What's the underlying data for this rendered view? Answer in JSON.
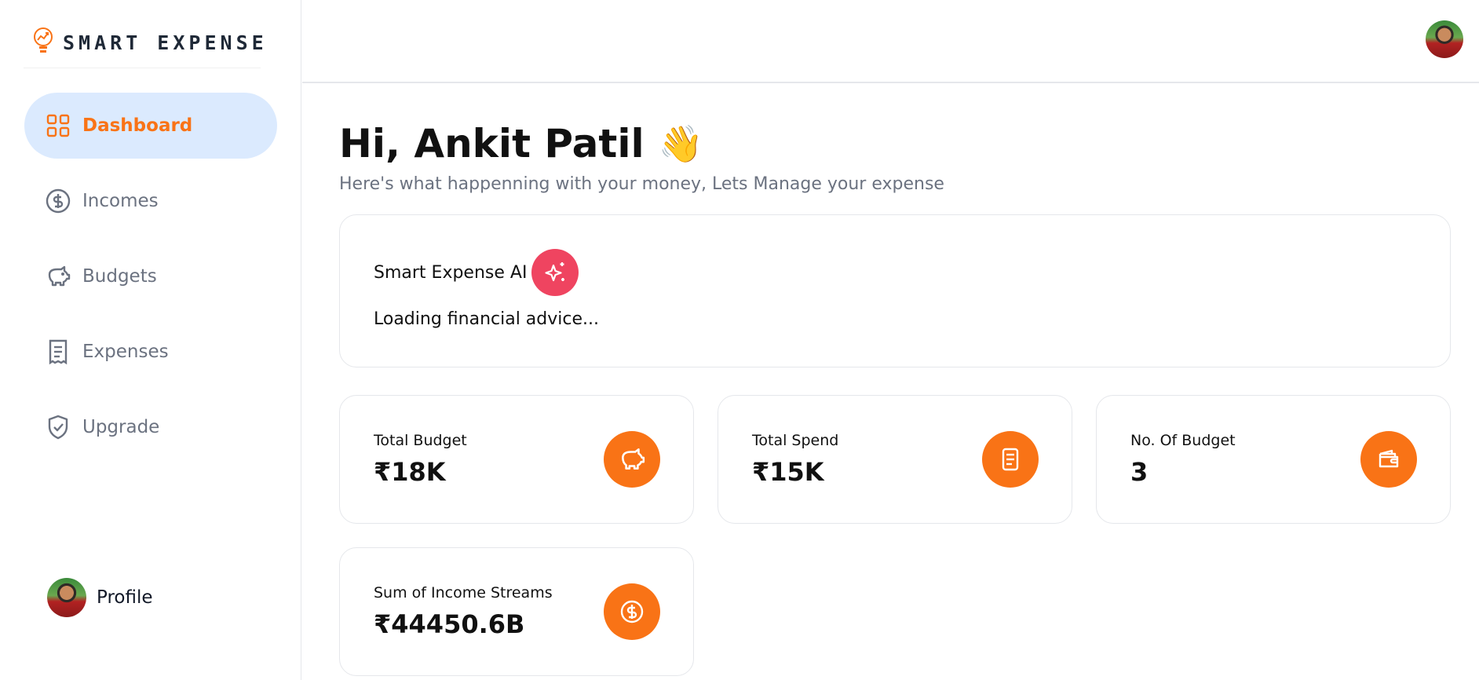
{
  "app": {
    "logo_text": "SMART EXPENSE",
    "accent_color": "#f97316"
  },
  "sidebar": {
    "items": [
      {
        "label": "Dashboard",
        "icon": "grid-icon",
        "active": true
      },
      {
        "label": "Incomes",
        "icon": "dollar-circle-icon",
        "active": false
      },
      {
        "label": "Budgets",
        "icon": "piggy-bank-icon",
        "active": false
      },
      {
        "label": "Expenses",
        "icon": "receipt-icon",
        "active": false
      },
      {
        "label": "Upgrade",
        "icon": "shield-check-icon",
        "active": false
      }
    ],
    "profile_label": "Profile"
  },
  "header": {
    "greeting": "Hi, Ankit Patil",
    "wave_emoji": "👋",
    "subtitle": "Here's what happenning with your money, Lets Manage your expense"
  },
  "ai_card": {
    "title": "Smart Expense AI",
    "message": "Loading financial advice...",
    "badge_color": "#ef4460"
  },
  "stats": [
    {
      "label": "Total Budget",
      "value": "₹18K",
      "icon": "piggy-bank-icon"
    },
    {
      "label": "Total Spend",
      "value": "₹15K",
      "icon": "receipt-icon"
    },
    {
      "label": "No. Of Budget",
      "value": "3",
      "icon": "wallet-icon"
    },
    {
      "label": "Sum of Income Streams",
      "value": "₹44450.6B",
      "icon": "dollar-circle-icon"
    }
  ]
}
